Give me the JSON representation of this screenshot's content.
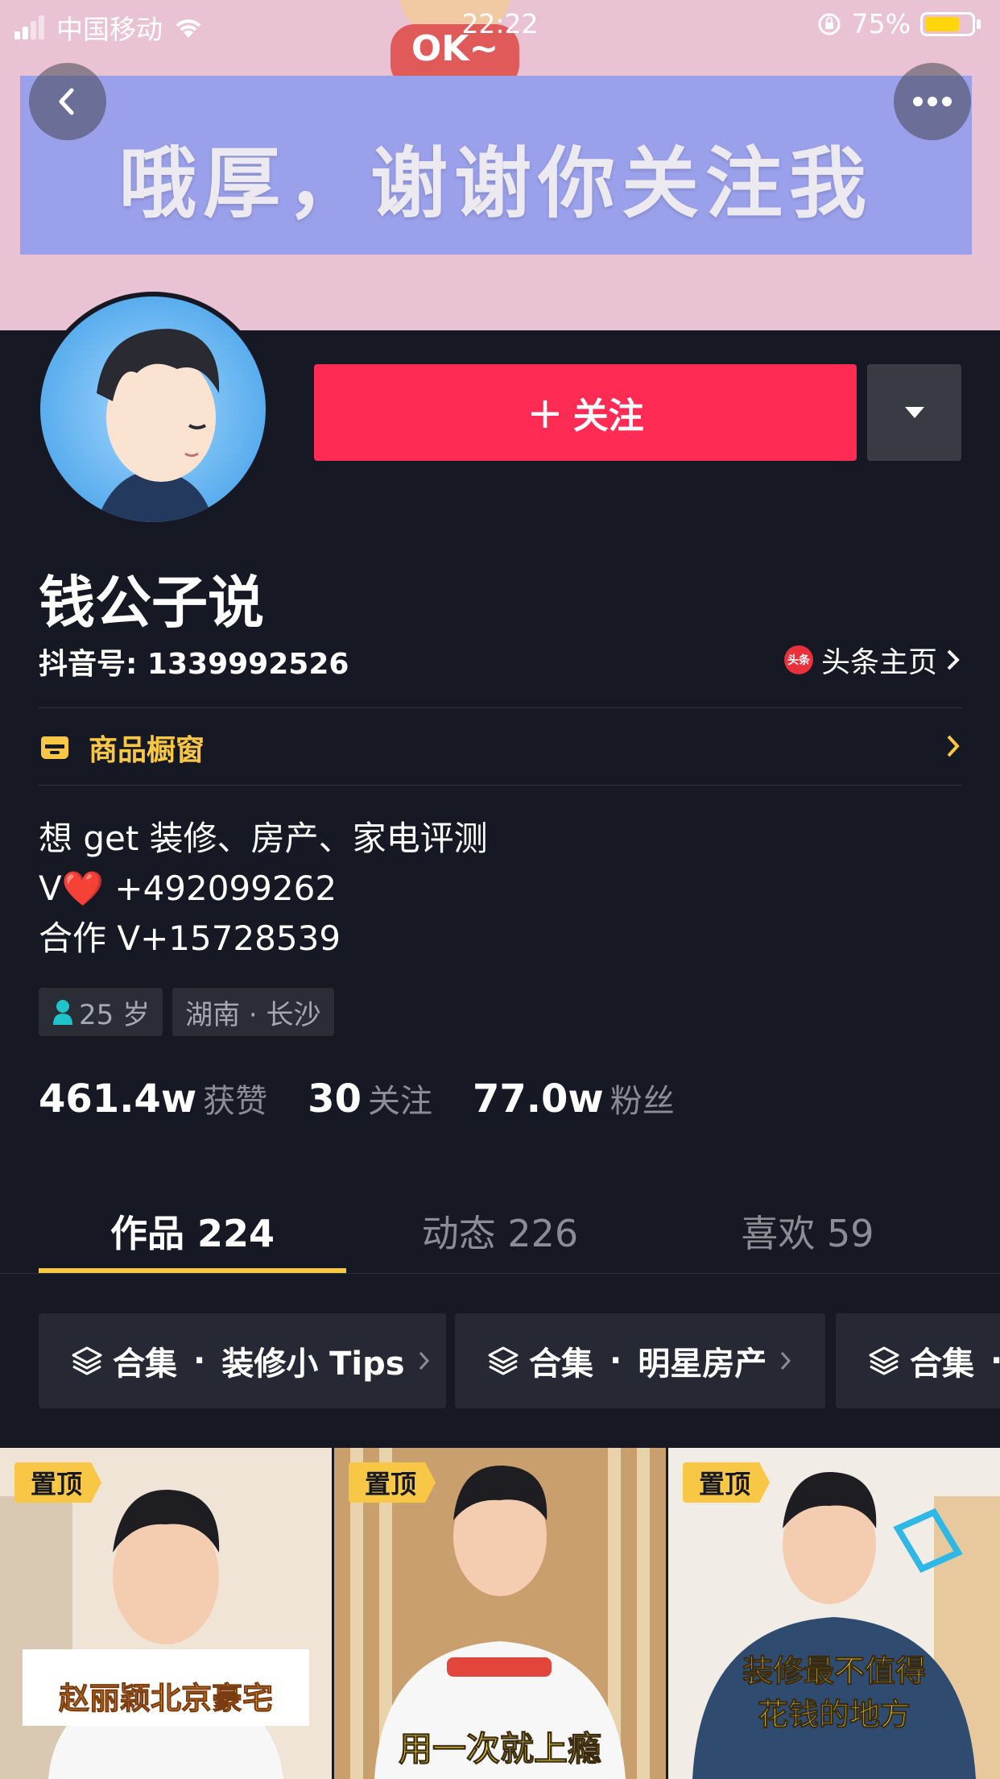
{
  "status_bar": {
    "carrier": "中国移动",
    "time": "22:22",
    "battery_percent": "75%",
    "battery_level": 0.75
  },
  "banner": {
    "text": "哦厚，谢谢你关注我",
    "figure_text": "OK~"
  },
  "profile": {
    "name": "钱公子说",
    "douyin_id": "抖音号: 1339992526",
    "toutiao_badge": "头条",
    "toutiao_link": "头条主页",
    "follow_label": "关注",
    "shop_label": "商品橱窗",
    "bio": [
      "想 get 装修、房产、家电评测",
      "V❤️ +492099262",
      "合作 V+15728539"
    ],
    "tags": {
      "age": "25 岁",
      "location": "湖南 · 长沙"
    },
    "stats": [
      {
        "value": "461.4w",
        "label": "获赞"
      },
      {
        "value": "30",
        "label": "关注"
      },
      {
        "value": "77.0w",
        "label": "粉丝"
      }
    ]
  },
  "tabs": [
    {
      "label": "作品 224"
    },
    {
      "label": "动态 226"
    },
    {
      "label": "喜欢 59"
    }
  ],
  "collections": [
    {
      "prefix": "合集",
      "dot": "·",
      "name": "装修小 Tips"
    },
    {
      "prefix": "合集",
      "dot": "·",
      "name": "明星房产"
    },
    {
      "prefix": "合集",
      "dot": "·",
      "name": ""
    }
  ],
  "videos": [
    {
      "pin": "置顶",
      "caption": "赵丽颖北京豪宅"
    },
    {
      "pin": "置顶",
      "caption": "用一次就上瘾"
    },
    {
      "pin": "置顶",
      "caption_line1": "装修最不值得",
      "caption_line2": "花钱的地方"
    }
  ],
  "colors": {
    "accent_red": "#fe2c55",
    "accent_yellow": "#f8c745",
    "background": "#161823"
  },
  "icons": {
    "back": "back-icon",
    "more": "more-icon",
    "dropdown": "chevron-down-icon",
    "shop": "shop-icon",
    "user": "user-icon",
    "collection": "layers-icon"
  }
}
